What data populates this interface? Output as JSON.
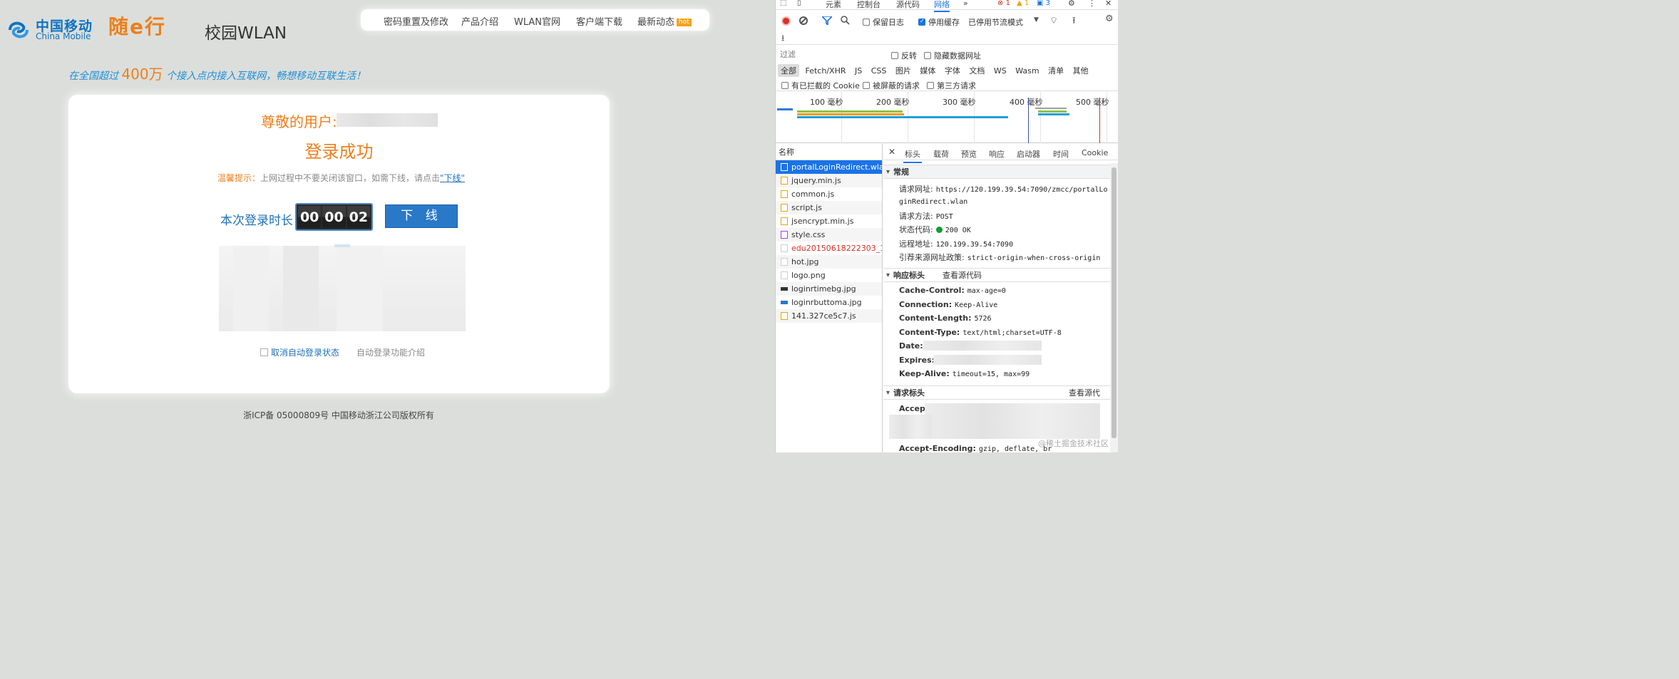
{
  "portal": {
    "brand_cn": "中国移动",
    "brand_en": "China Mobile",
    "sui_logo": "随e行",
    "campus_title": "校园WLAN",
    "nav": [
      "密码重置及修改",
      "产品介绍",
      "WLAN官网",
      "客户端下载",
      "最新动态"
    ],
    "nav_hot_badge": "hot",
    "slogan_pre": "在全国超过",
    "slogan_num": "400万",
    "slogan_post": "个接入点内接入互联网，畅想移动互联生活！",
    "greeting": "尊敬的用户:",
    "success_title": "登录成功",
    "tip_label": "温馨提示：",
    "tip_text": "上网过程中不要关闭该窗口，如需下线，请点击",
    "tip_link": "\"下线\"",
    "duration_label": "本次登录时长",
    "timer": [
      "00",
      "00",
      "02"
    ],
    "logout_button": "下 线",
    "cancel_auto_login": "取消自动登录状态",
    "auto_login_intro": "自动登录功能介绍",
    "footer": "浙ICP备 05000809号 中国移动浙江公司版权所有"
  },
  "devtools": {
    "tabs": [
      "元素",
      "控制台",
      "源代码",
      "网络"
    ],
    "active_tab": "网络",
    "more": "»",
    "counts": {
      "errors": "1",
      "warnings": "1",
      "messages": "3"
    },
    "toolbar": {
      "preserve_log": "保留日志",
      "disable_cache": "停用缓存",
      "throttle": "已停用节流模式"
    },
    "filter_placeholder": "过滤",
    "invert": "反转",
    "hide_data_urls": "隐藏数据网址",
    "types": [
      "全部",
      "Fetch/XHR",
      "JS",
      "CSS",
      "图片",
      "媒体",
      "字体",
      "文档",
      "WS",
      "Wasm",
      "清单",
      "其他"
    ],
    "blocked_cookies": "有已拦截的 Cookie",
    "blocked_requests": "被屏蔽的请求",
    "third_party": "第三方请求",
    "timeline_labels": [
      "100 毫秒",
      "200 毫秒",
      "300 毫秒",
      "400 毫秒",
      "500 毫秒"
    ],
    "name_header": "名称",
    "requests": [
      {
        "name": "portalLoginRedirect.wlan",
        "type": "doc"
      },
      {
        "name": "jquery.min.js",
        "type": "js"
      },
      {
        "name": "common.js",
        "type": "js"
      },
      {
        "name": "script.js",
        "type": "js"
      },
      {
        "name": "jsencrypt.min.js",
        "type": "js"
      },
      {
        "name": "style.css",
        "type": "css"
      },
      {
        "name": "edu20150618222303_1.j...",
        "type": "img"
      },
      {
        "name": "hot.jpg",
        "type": "img"
      },
      {
        "name": "logo.png",
        "type": "img"
      },
      {
        "name": "loginrtimebg.jpg",
        "type": "jpgdark"
      },
      {
        "name": "loginrbuttoma.jpg",
        "type": "jpgblue"
      },
      {
        "name": "141.327ce5c7.js",
        "type": "js"
      }
    ],
    "detail_tabs": [
      "标头",
      "载荷",
      "预览",
      "响应",
      "启动器",
      "时间",
      "Cookie"
    ],
    "general": {
      "title": "常规",
      "url_label": "请求网址:",
      "url_line1": "https://120.199.39.54:7090/zmcc/portalLo",
      "url_line2": "ginRedirect.wlan",
      "method_label": "请求方法:",
      "method": "POST",
      "status_label": "状态代码:",
      "status": "200 OK",
      "remote_label": "远程地址:",
      "remote": "120.199.39.54:7090",
      "referrer_label": "引荐来源网址政策:",
      "referrer": "strict-origin-when-cross-origin"
    },
    "response_headers": {
      "title": "响应标头",
      "view_source": "查看源代码",
      "cache_control_k": "Cache-Control:",
      "cache_control_v": "max-age=0",
      "connection_k": "Connection:",
      "connection_v": "Keep-Alive",
      "content_length_k": "Content-Length:",
      "content_length_v": "5726",
      "content_type_k": "Content-Type:",
      "content_type_v": "text/html;charset=UTF-8",
      "date_k": "Date:",
      "expires_k": "Expires:",
      "keep_alive_k": "Keep-Alive:",
      "keep_alive_v": "timeout=15, max=99"
    },
    "request_headers": {
      "title": "请求标头",
      "view_source": "查看源代",
      "accept_k": "Accept:",
      "accept_encoding_k": "Accept-Encoding:",
      "accept_encoding_v": "gzip, deflate, br"
    },
    "watermark": "@稀土掘金技术社区"
  }
}
